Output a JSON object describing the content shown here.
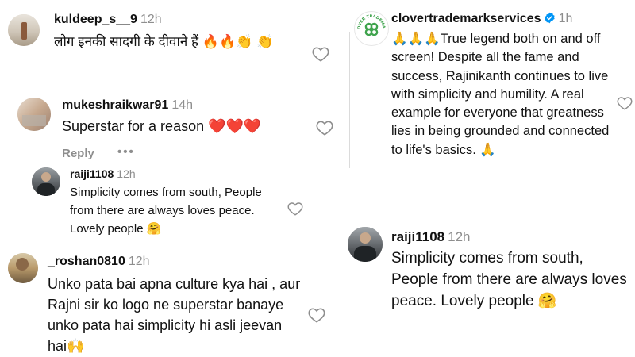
{
  "comments_left": [
    {
      "username": "kuldeep_s__9",
      "time": "12h",
      "text": "लोग इनकी सादगी के दीवाने हैं 🔥🔥👏 👏"
    },
    {
      "username": "mukeshraikwar91",
      "time": "14h",
      "text": "Superstar for a reason ❤️❤️❤️",
      "reply_label": "Reply",
      "more_label": "•••"
    },
    {
      "username": "raiji1108",
      "time": "12h",
      "text": "Simplicity comes from south, People from there are always loves peace. Lovely people 🤗"
    },
    {
      "username": "_roshan0810",
      "time": "12h",
      "text": "Unko pata bai apna culture kya hai , aur Rajni sir ko logo ne superstar banaye unko pata hai simplicity hi asli jeevan hai🙌"
    }
  ],
  "comments_right": [
    {
      "username": "clovertrademarkservices",
      "time": "1h",
      "verified": true,
      "logo_text": "CLOVER TRADEMARK",
      "text": "🙏🙏🙏True legend both on and off screen! Despite all the fame and success, Rajinikanth continues to live with simplicity and humility. A real example for everyone that greatness lies in being grounded and connected to life's basics. 🙏"
    },
    {
      "username": "raiji1108",
      "time": "12h",
      "text": "Simplicity comes from south, People from there are always loves peace. Lovely people 🤗"
    }
  ],
  "icons": {
    "like": "heart-outline-icon",
    "verified": "verified-badge-icon",
    "more": "more-dots-icon"
  },
  "colors": {
    "text": "#111111",
    "muted": "#8e8e8e",
    "verified": "#0095f6",
    "divider": "#dbdbdb",
    "clover_green": "#3fa34d"
  }
}
